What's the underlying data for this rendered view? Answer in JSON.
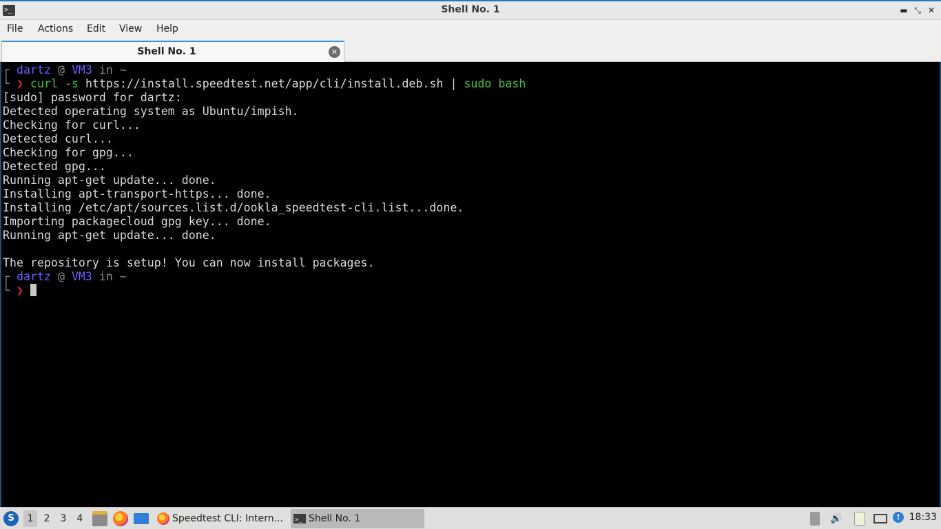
{
  "window": {
    "title": "Shell No. 1",
    "app_icon_glyph": ">_",
    "controls": {
      "minimize": "▬",
      "maximize": "⤡",
      "close": "✕"
    }
  },
  "menu": [
    "File",
    "Actions",
    "Edit",
    "View",
    "Help"
  ],
  "tabs": [
    {
      "label": "Shell No. 1",
      "close_glyph": "✕"
    }
  ],
  "terminal": {
    "prompt": {
      "user": "dartz",
      "at": "@",
      "host": "VM3",
      "in": "in",
      "dir": "~",
      "arrow": "❯"
    },
    "command": {
      "curl": "curl",
      "flag": "-s",
      "url": "https://install.speedtest.net/app/cli/install.deb.sh",
      "pipe": "|",
      "sudo": "sudo bash"
    },
    "output": [
      "[sudo] password for dartz:",
      "Detected operating system as Ubuntu/impish.",
      "Checking for curl...",
      "Detected curl...",
      "Checking for gpg...",
      "Detected gpg...",
      "Running apt-get update... done.",
      "Installing apt-transport-https... done.",
      "Installing /etc/apt/sources.list.d/ookla_speedtest-cli.list...done.",
      "Importing packagecloud gpg key... done.",
      "Running apt-get update... done.",
      "",
      "The repository is setup! You can now install packages."
    ]
  },
  "taskbar": {
    "start_glyph": "S",
    "desktops": [
      "1",
      "2",
      "3",
      "4"
    ],
    "active_desktop": "1",
    "tasks": [
      {
        "label": "Speedtest CLI: Intern...",
        "icon": "firefox-icon",
        "active": false
      },
      {
        "label": "Shell No. 1",
        "icon": "terminal-icon",
        "active": true
      }
    ],
    "tray": {
      "volume_glyph": "🔊",
      "notification_glyph": "!",
      "clock": "18:33"
    }
  },
  "colors": {
    "accent": "#2a76c6",
    "prompt_user": "#6e5cff",
    "command_green": "#3ec23e",
    "prompt_arrow": "#e0204a",
    "terminal_bg": "#000000"
  }
}
